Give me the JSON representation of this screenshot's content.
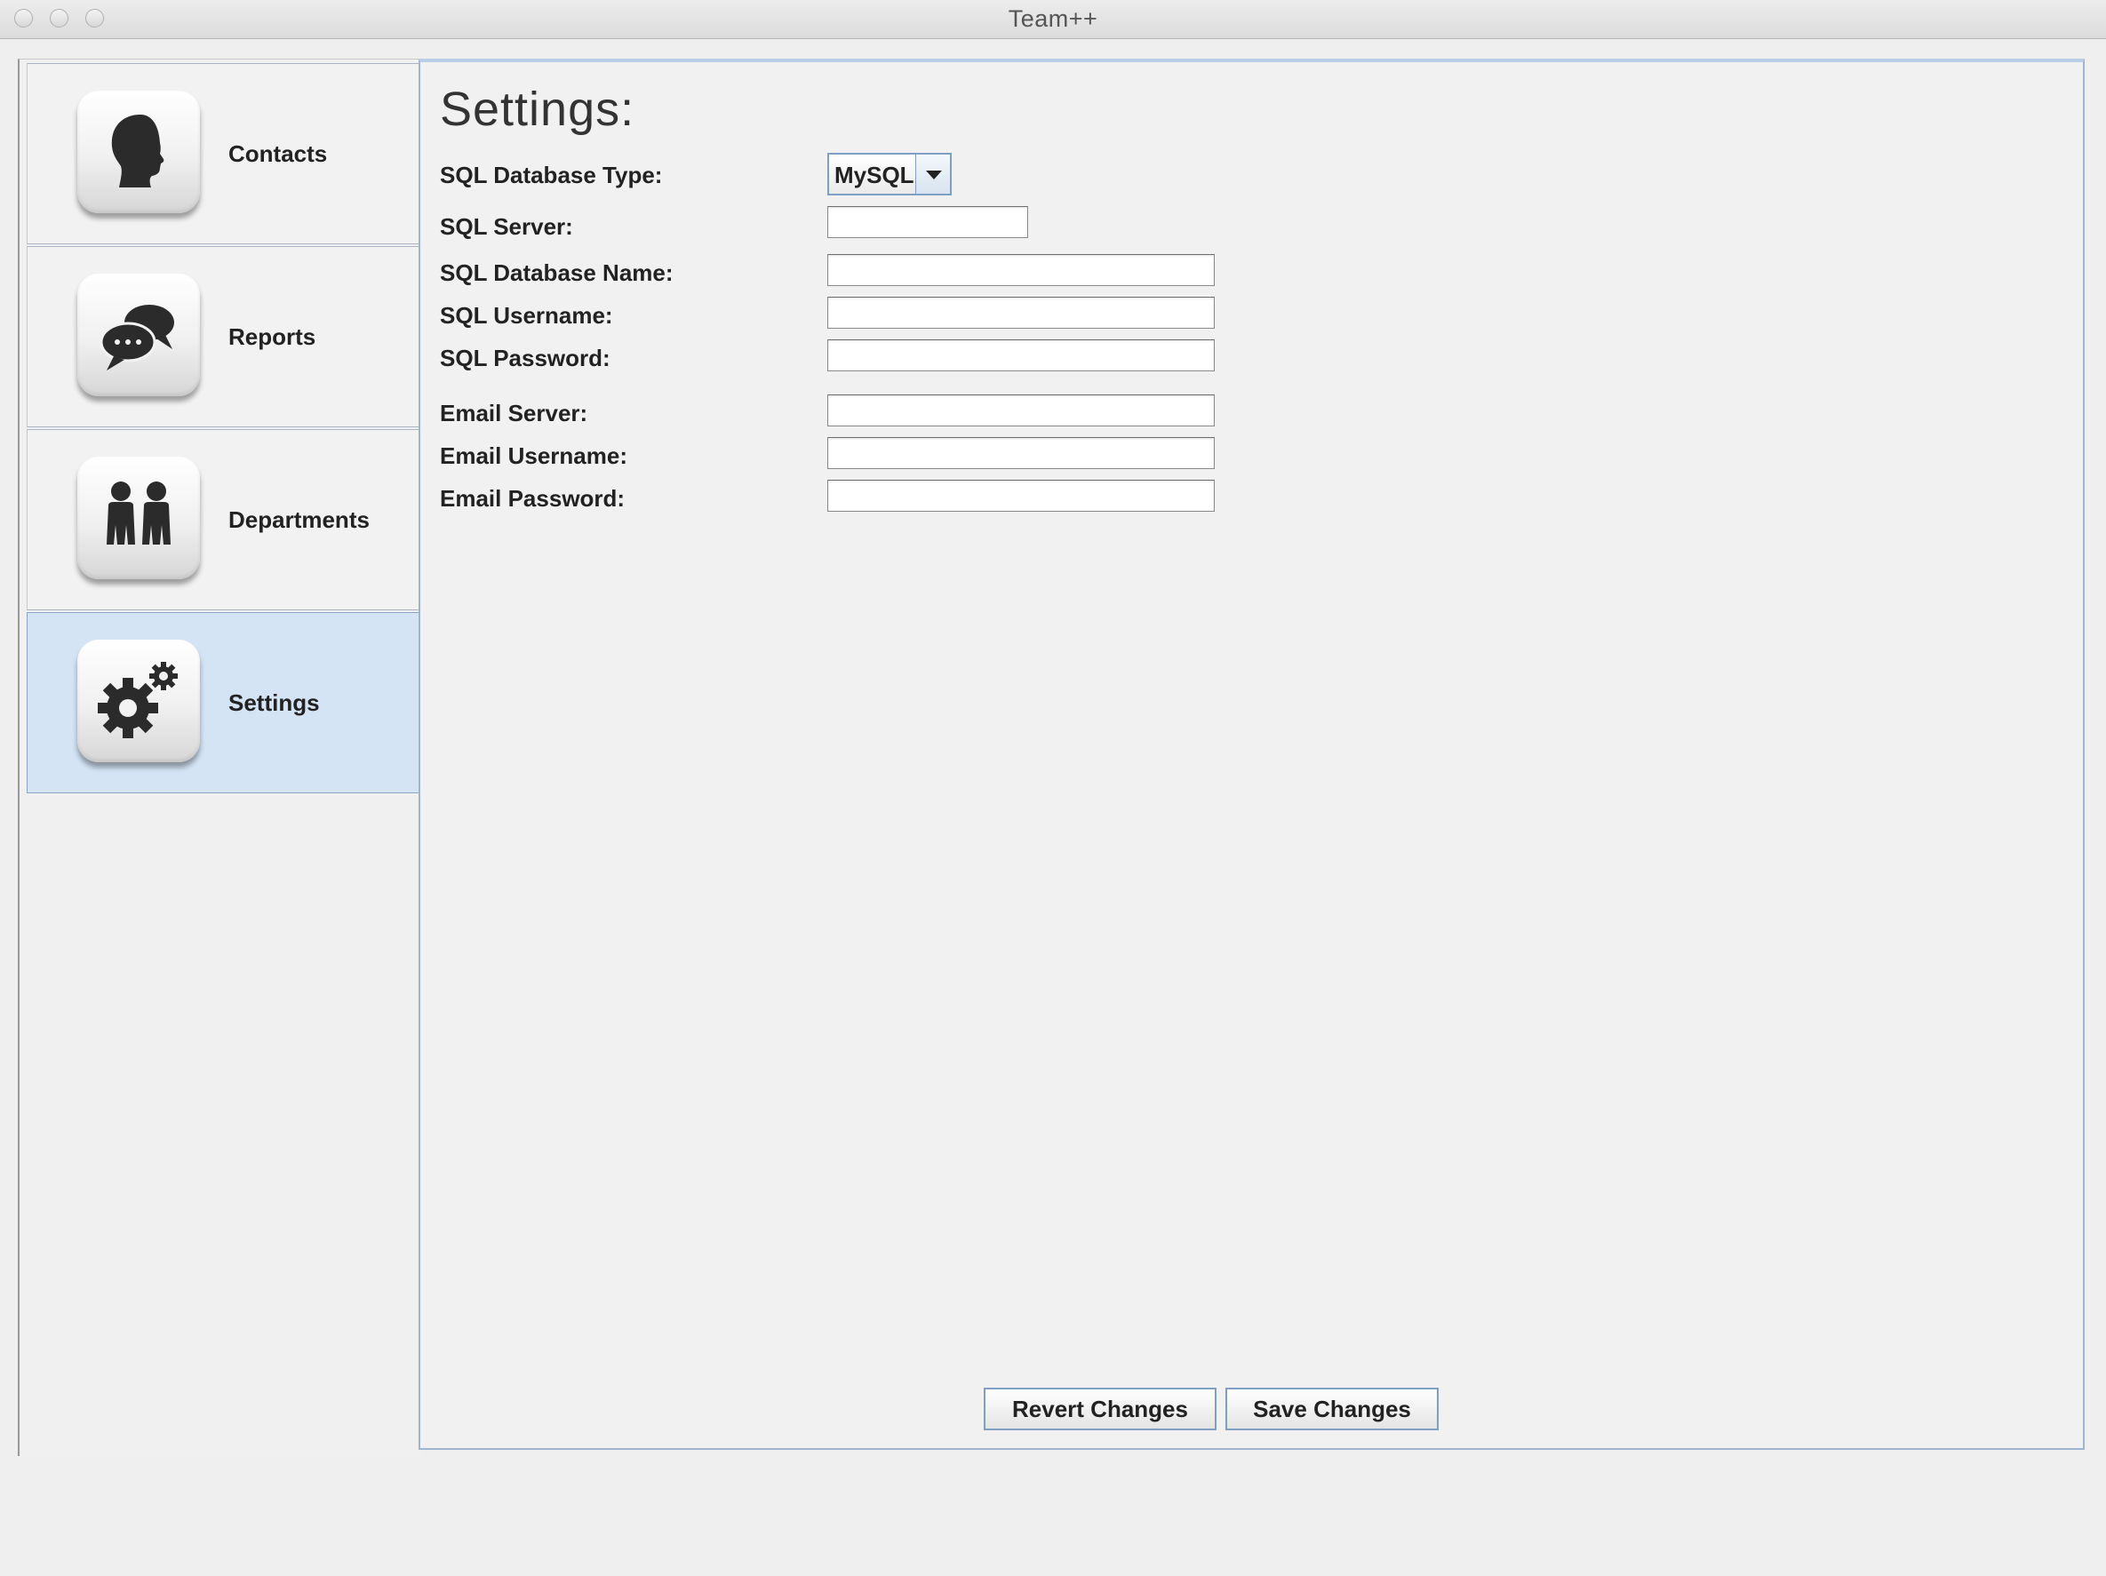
{
  "window": {
    "title": "Team++"
  },
  "sidebar": {
    "items": [
      {
        "label": "Contacts",
        "icon": "contact-head-icon",
        "selected": false
      },
      {
        "label": "Reports",
        "icon": "speech-bubbles-icon",
        "selected": false
      },
      {
        "label": "Departments",
        "icon": "people-icon",
        "selected": false
      },
      {
        "label": "Settings",
        "icon": "gears-icon",
        "selected": true
      }
    ]
  },
  "settings": {
    "title": "Settings:",
    "fields": {
      "db_type": {
        "label": "SQL Database Type:",
        "value": "MySQL"
      },
      "sql_server": {
        "label": "SQL Server:",
        "value": ""
      },
      "db_name": {
        "label": "SQL Database Name:",
        "value": ""
      },
      "sql_username": {
        "label": "SQL Username:",
        "value": ""
      },
      "sql_password": {
        "label": "SQL Password:",
        "value": ""
      },
      "email_server": {
        "label": "Email Server:",
        "value": ""
      },
      "email_username": {
        "label": "Email Username:",
        "value": ""
      },
      "email_password": {
        "label": "Email Password:",
        "value": ""
      }
    },
    "buttons": {
      "revert": "Revert Changes",
      "save": "Save Changes"
    }
  },
  "colors": {
    "selection": "#d4e4f5",
    "accent_border": "#7f9fc4",
    "icon_glyph": "#2b2b2b"
  }
}
